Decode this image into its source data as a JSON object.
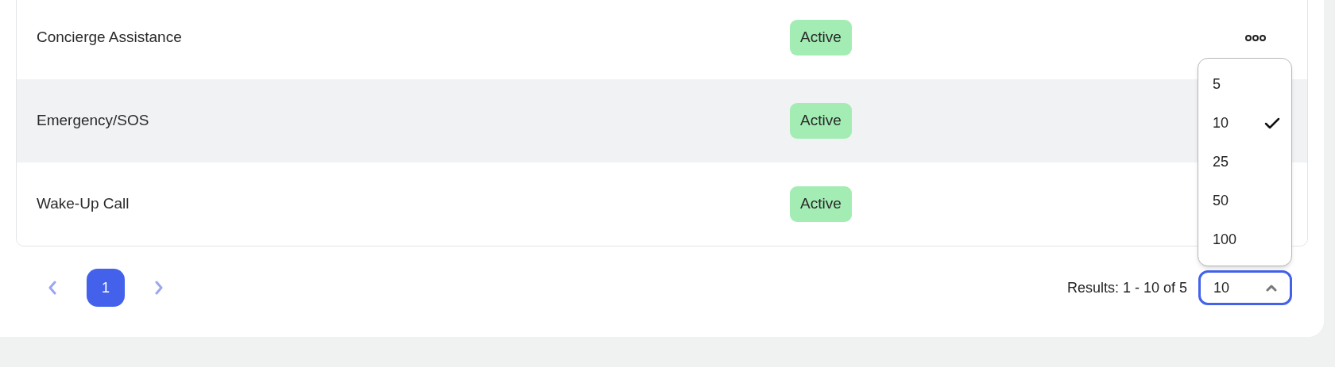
{
  "table": {
    "rows": [
      {
        "name": "Concierge Assistance",
        "status": "Active",
        "actions": true,
        "highlighted": false
      },
      {
        "name": "Emergency/SOS",
        "status": "Active",
        "actions": false,
        "highlighted": true
      },
      {
        "name": "Wake-Up Call",
        "status": "Active",
        "actions": false,
        "highlighted": false
      }
    ]
  },
  "pagination": {
    "pages": [
      {
        "label": "1",
        "selected": true
      }
    ],
    "results": "Results: 1 - 10 of 5",
    "page_size": {
      "value": "10",
      "expanded": true,
      "options": [
        {
          "label": "5",
          "selected": false
        },
        {
          "label": "10",
          "selected": true
        },
        {
          "label": "25",
          "selected": false
        },
        {
          "label": "50",
          "selected": false
        },
        {
          "label": "100",
          "selected": false
        }
      ]
    }
  }
}
